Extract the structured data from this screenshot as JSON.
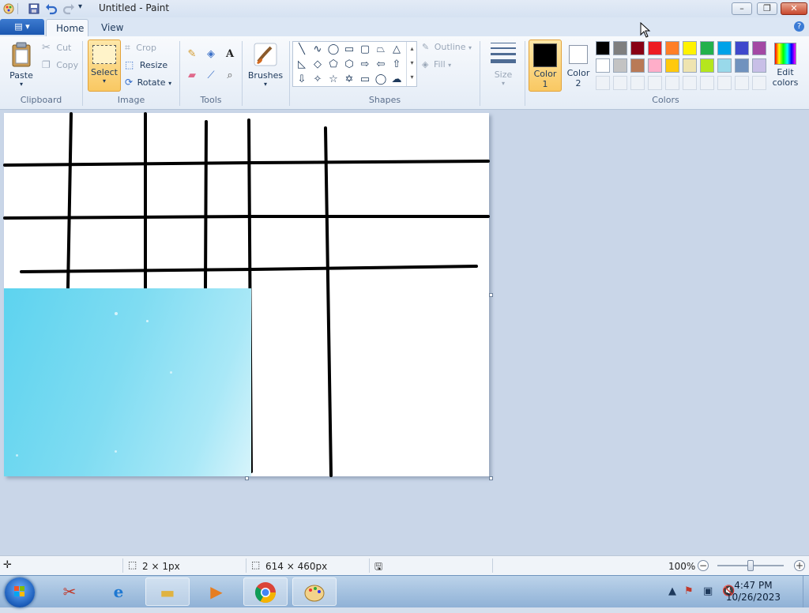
{
  "window": {
    "title": "Untitled - Paint"
  },
  "title_controls": {
    "minimize": "–",
    "maximize": "❐",
    "close": "✕"
  },
  "tabs": [
    {
      "label": "Home",
      "active": true
    },
    {
      "label": "View",
      "active": false
    }
  ],
  "ribbon": {
    "clipboard": {
      "group": "Clipboard",
      "paste": "Paste",
      "cut": "Cut",
      "copy": "Copy"
    },
    "image": {
      "group": "Image",
      "select": "Select",
      "crop": "Crop",
      "resize": "Resize",
      "rotate": "Rotate"
    },
    "tools": {
      "group": "Tools"
    },
    "brushes": {
      "label": "Brushes"
    },
    "shapes": {
      "group": "Shapes",
      "outline": "Outline",
      "fill": "Fill"
    },
    "size": {
      "label": "Size"
    },
    "colors": {
      "group": "Colors",
      "color1_line1": "Color",
      "color1_line2": "1",
      "color2_line1": "Color",
      "color2_line2": "2",
      "edit_line1": "Edit",
      "edit_line2": "colors",
      "color1_value": "#000000",
      "color2_value": "#ffffff",
      "palette_row1": [
        "#000000",
        "#7f7f7f",
        "#880015",
        "#ed1c24",
        "#ff7f27",
        "#fff200",
        "#22b14c",
        "#00a2e8",
        "#3f48cc",
        "#a349a4"
      ],
      "palette_row2": [
        "#ffffff",
        "#c3c3c3",
        "#b97a57",
        "#ffaec9",
        "#ffc90e",
        "#efe4b0",
        "#b5e61d",
        "#99d9ea",
        "#7092be",
        "#c8bfe7"
      ]
    }
  },
  "status": {
    "selection_size": "2 × 1px",
    "image_size": "614 × 460px",
    "zoom": "100%"
  },
  "taskbar": {
    "time": "4:47 PM",
    "date": "10/26/2023"
  }
}
